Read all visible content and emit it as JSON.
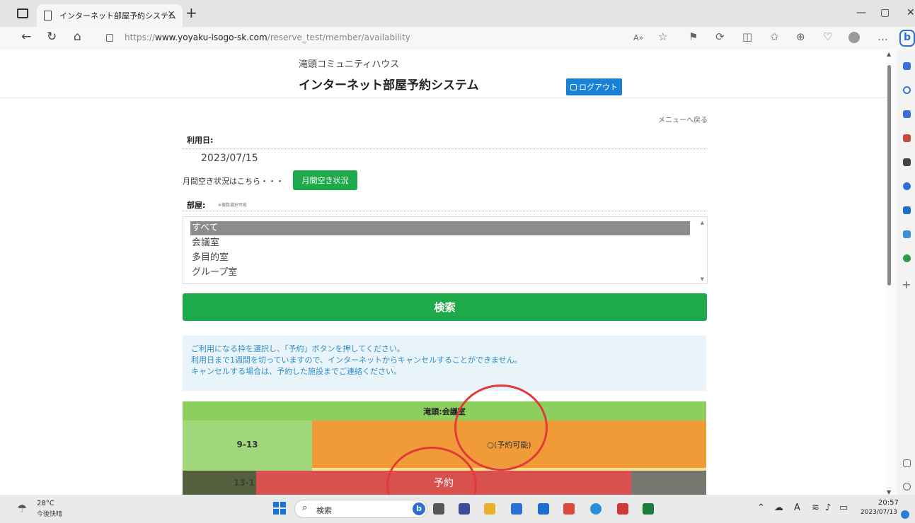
{
  "browser": {
    "tab_title": "インターネット部屋予約システム",
    "tab_close": "×",
    "new_tab": "+",
    "url_scheme": "https://",
    "url_host": "www.yoyaku-isogo-sk.com",
    "url_path": "/reserve_test/member/availability",
    "minimize": "—",
    "maximize": "▢",
    "close": "✕",
    "back": "←",
    "refresh": "↻",
    "home": "⌂",
    "toolbar_icons": [
      "A»",
      "☆",
      "⚑",
      "⟳",
      "◫",
      "✩",
      "⊕",
      "♡",
      "…"
    ],
    "bing_label": "b"
  },
  "header": {
    "facility": "滝頭コミュニティハウス",
    "title": "インターネット部屋予約システム",
    "logout": "ログアウト"
  },
  "form": {
    "back_to_menu": "メニューへ戻る",
    "date_label": "利用日:",
    "date_value": "2023/07/15",
    "monthly_text": "月間空き状況はこちら・・・",
    "monthly_button": "月間空き状況",
    "room_label": "部屋:",
    "room_note": "※複数選択可能",
    "rooms": [
      "すべて",
      "会議室",
      "多目的室",
      "グループ室"
    ],
    "selected_room": "すべて",
    "search_button": "検索"
  },
  "info": {
    "lines": [
      "ご利用になる枠を選択し、「予約」ボタンを押してください。",
      "利用日まで1週間を切っていますので、インターネットからキャンセルすることができません。",
      "キャンセルする場合は、予約した施設までご連絡ください。"
    ]
  },
  "results": {
    "room_header": "滝頭:会議室",
    "slot_time": "9-13",
    "slot_status": "○(予約可能)",
    "next_slot_partial": "13-1",
    "reserve_button": "予約"
  },
  "taskbar": {
    "temp": "28°C",
    "weather": "今後快晴",
    "search_placeholder": "検索",
    "clock_time": "20:57",
    "clock_date": "2023/07/13",
    "tray_a": "A"
  },
  "colors": {
    "primary_green": "#1ea94a",
    "logout_blue": "#1a82d6",
    "available_orange": "#f19a38",
    "annotation_red": "#e23a3a"
  }
}
